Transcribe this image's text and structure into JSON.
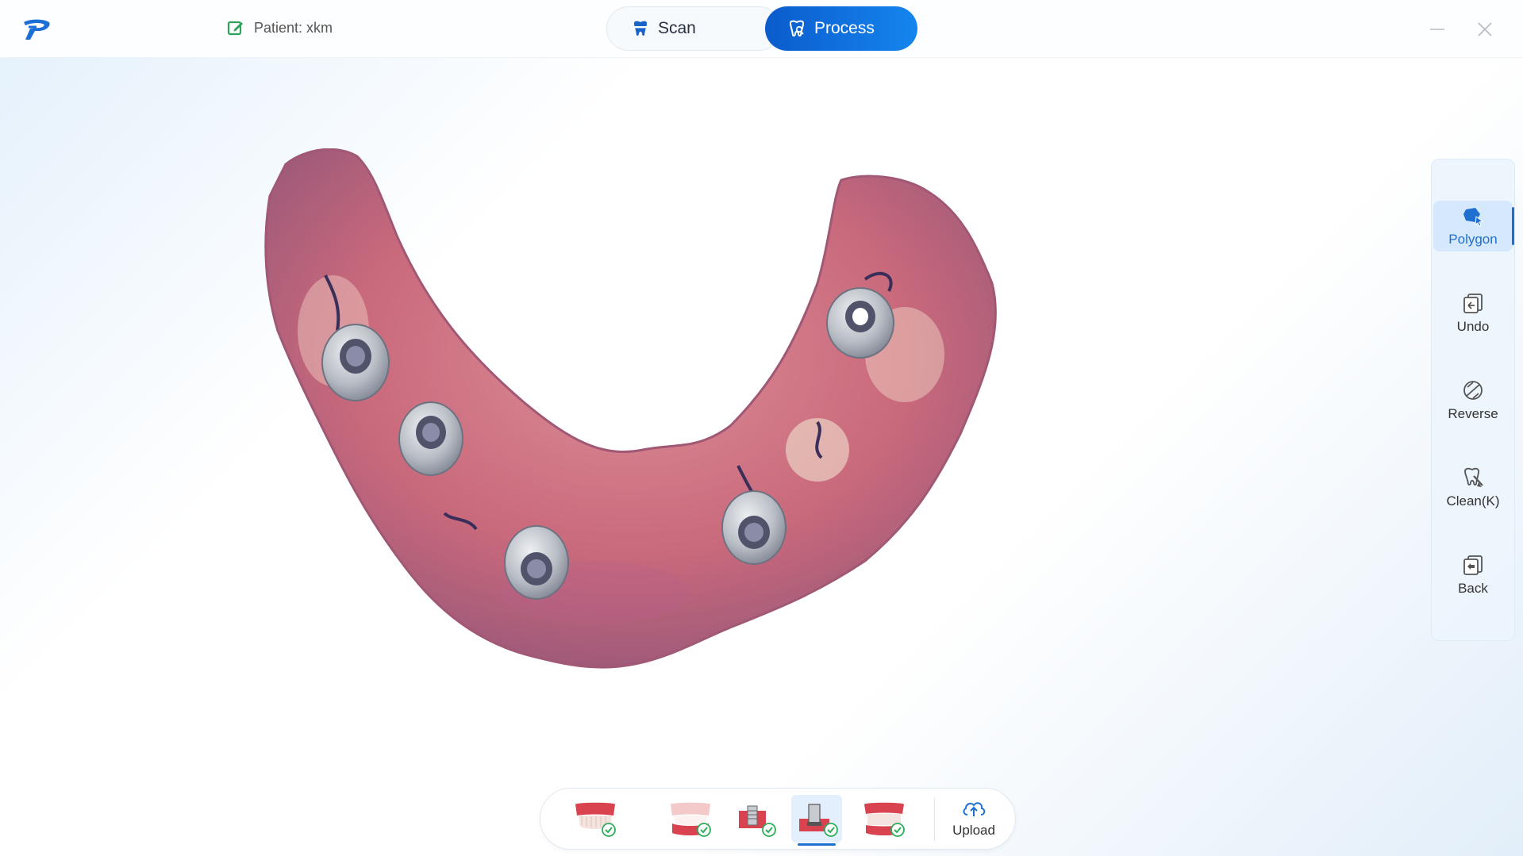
{
  "header": {
    "patient_label": "Patient: xkm",
    "tabs": [
      {
        "label": "Scan",
        "active": false
      },
      {
        "label": "Process",
        "active": true
      }
    ]
  },
  "tools": [
    {
      "label": "Polygon",
      "icon": "polygon-select-icon",
      "active": true
    },
    {
      "label": "Undo",
      "icon": "undo-icon",
      "active": false
    },
    {
      "label": "Reverse",
      "icon": "reverse-icon",
      "active": false
    },
    {
      "label": "Clean(K)",
      "icon": "clean-icon",
      "active": false
    },
    {
      "label": "Back",
      "icon": "back-icon",
      "active": false
    }
  ],
  "bottom_toolbar": {
    "steps": [
      {
        "icon": "upper-jaw-check-icon",
        "done": true
      },
      {
        "icon": "lower-jaw-check-icon",
        "done": true
      },
      {
        "icon": "implant-scanbody-check-icon",
        "done": true
      },
      {
        "icon": "scanbody-lower-check-icon",
        "done": true,
        "active": true
      },
      {
        "icon": "bite-check-icon",
        "done": true
      }
    ],
    "upload_label": "Upload"
  },
  "colors": {
    "accent": "#1585ee",
    "accent_dark": "#0b5bcc",
    "tissue": "#c8667a",
    "check": "#2fae5a"
  }
}
